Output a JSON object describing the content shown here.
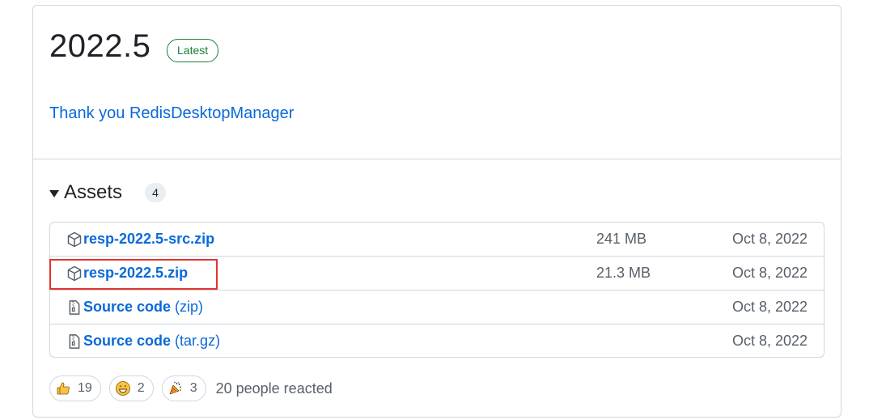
{
  "release": {
    "title": "2022.5",
    "badge": "Latest",
    "notes_link": "Thank you RedisDesktopManager"
  },
  "assets": {
    "heading": "Assets",
    "count": "4",
    "items": [
      {
        "name": "resp-2022.5-src.zip",
        "suffix": "",
        "size": "241 MB",
        "date": "Oct 8, 2022",
        "icon": "package-icon"
      },
      {
        "name": "resp-2022.5.zip",
        "suffix": "",
        "size": "21.3 MB",
        "date": "Oct 8, 2022",
        "icon": "package-icon"
      },
      {
        "name": "Source code",
        "suffix": "(zip)",
        "size": "",
        "date": "Oct 8, 2022",
        "icon": "file-zip-icon"
      },
      {
        "name": "Source code",
        "suffix": "(tar.gz)",
        "size": "",
        "date": "Oct 8, 2022",
        "icon": "file-zip-icon"
      }
    ]
  },
  "reactions": {
    "items": [
      {
        "emoji": "thumbs-up-icon",
        "count": "19"
      },
      {
        "emoji": "smile-icon",
        "count": "2"
      },
      {
        "emoji": "tada-icon",
        "count": "3"
      }
    ],
    "summary": "20 people reacted"
  },
  "colors": {
    "link": "#0969da",
    "latest_badge": "#1a7f37",
    "highlight_box": "#e3342f",
    "border": "#d0d7de"
  }
}
